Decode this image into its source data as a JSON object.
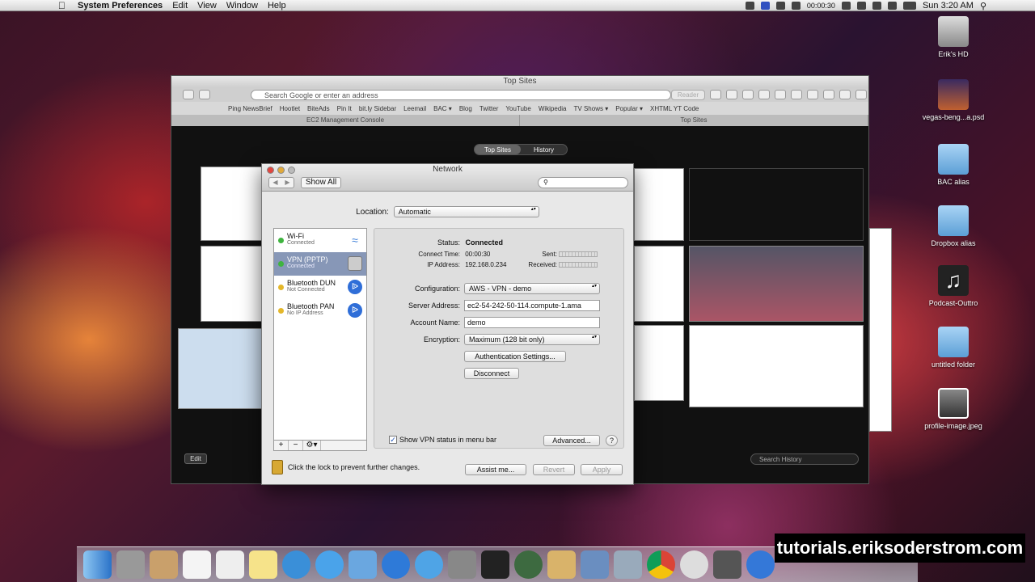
{
  "menubar": {
    "app_name": "System Preferences",
    "items": [
      "Edit",
      "View",
      "Window",
      "Help"
    ],
    "timer": "00:00:30",
    "clock": "Sun 3:20 AM"
  },
  "desktop_icons": [
    {
      "label": "Erik's HD"
    },
    {
      "label": "vegas-beng...a.psd"
    },
    {
      "label": "BAC alias"
    },
    {
      "label": "Dropbox alias"
    },
    {
      "label": "Podcast-Outtro"
    },
    {
      "label": "untitled folder"
    },
    {
      "label": "profile-image.jpeg"
    }
  ],
  "safari": {
    "title": "Top Sites",
    "address_placeholder": "Search Google or enter an address",
    "reader_label": "Reader",
    "bookmarks": [
      "Ping NewsBrief",
      "Hootlet",
      "BiteAds",
      "Pin It",
      "bit.ly Sidebar",
      "Leemail",
      "BAC ▾",
      "Blog",
      "Twitter",
      "YouTube",
      "Wikipedia",
      "TV Shows ▾",
      "Popular ▾",
      "XHTML YT Code"
    ],
    "tabs": [
      "EC2 Management Console",
      "Top Sites"
    ],
    "segment": [
      "Top Sites",
      "History"
    ],
    "edit_label": "Edit",
    "search_history_placeholder": "Search History"
  },
  "network": {
    "title": "Network",
    "show_all": "Show All",
    "location_label": "Location:",
    "location_value": "Automatic",
    "services": [
      {
        "name": "Wi-Fi",
        "status": "Connected",
        "dot": "#3fb43f",
        "icon": "wifi-icon"
      },
      {
        "name": "VPN (PPTP)",
        "status": "Connected",
        "dot": "#3fb43f",
        "icon": "lock-icon"
      },
      {
        "name": "Bluetooth DUN",
        "status": "Not Connected",
        "dot": "#e4b72a",
        "icon": "bluetooth-icon"
      },
      {
        "name": "Bluetooth PAN",
        "status": "No IP Address",
        "dot": "#e4b72a",
        "icon": "bluetooth-icon"
      }
    ],
    "status_label": "Status:",
    "status_value": "Connected",
    "connect_time_label": "Connect Time:",
    "connect_time_value": "00:00:30",
    "ip_label": "IP Address:",
    "ip_value": "192.168.0.234",
    "sent_label": "Sent:",
    "received_label": "Received:",
    "configuration_label": "Configuration:",
    "configuration_value": "AWS - VPN - demo",
    "server_label": "Server Address:",
    "server_value": "ec2-54-242-50-114.compute-1.ama",
    "account_label": "Account Name:",
    "account_value": "demo",
    "encryption_label": "Encryption:",
    "encryption_value": "Maximum (128 bit only)",
    "auth_button": "Authentication Settings...",
    "disconnect_button": "Disconnect",
    "show_vpn_label": "Show VPN status in menu bar",
    "advanced_button": "Advanced...",
    "help_button": "?",
    "lock_text": "Click the lock to prevent further changes.",
    "assist_button": "Assist me...",
    "revert_button": "Revert",
    "apply_button": "Apply"
  },
  "watermark": "tutorials.eriksoderstrom.com"
}
